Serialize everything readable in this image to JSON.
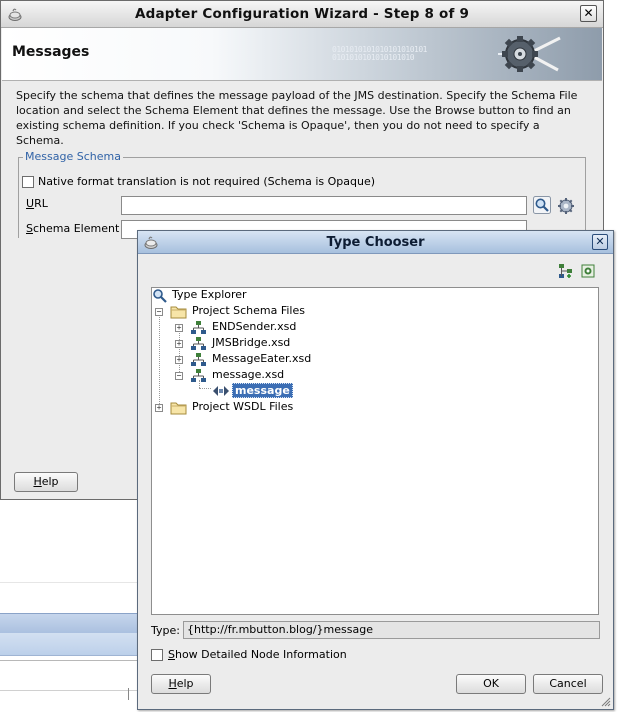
{
  "wizard": {
    "title": "Adapter Configuration Wizard - Step 8 of 9",
    "close_label": "✕",
    "banner_title": "Messages",
    "banner_bits": "0101010101010101010101\n0101010101010101010",
    "description": "Specify the schema that defines the message payload of the JMS destination.  Specify the Schema File location and select the Schema Element that defines the message. Use the Browse button to find an existing schema definition. If you check 'Schema is Opaque', then you do not need to specify a Schema.",
    "message_schema": {
      "legend": "Message Schema",
      "opaque_checkbox_label": "Native format translation is not required (Schema is Opaque)",
      "opaque_checked": false,
      "url_label_mnemonic": "U",
      "url_label_rest": "RL",
      "url_value": "",
      "schema_element_label_mnemonic": "S",
      "schema_element_label_rest": "chema Element",
      "schema_element_value": ""
    },
    "help_mnemonic": "H",
    "help_rest": "elp",
    "icons": [
      "app-icon",
      "search-icon",
      "gear-icon",
      "adapter-gear-icon"
    ]
  },
  "type_chooser": {
    "title": "Type Chooser",
    "close_label": "✕",
    "tree": {
      "root": "Type Explorer",
      "project_schema_files": "Project Schema Files",
      "files": [
        "ENDSender.xsd",
        "JMSBridge.xsd",
        "MessageEater.xsd",
        "message.xsd"
      ],
      "selected_element": "message",
      "project_wsdl_files": "Project WSDL Files"
    },
    "type_label": "Type:",
    "type_value": "{http://fr.mbutton.blog/}message",
    "show_detailed_mnemonic": "S",
    "show_detailed_rest": "how Detailed Node Information",
    "show_detailed_checked": false,
    "help_mnemonic": "H",
    "help_rest": "elp",
    "ok_label": "OK",
    "cancel_label": "Cancel",
    "icons": [
      "import-schema-icon",
      "browse-schema-icon",
      "folder-icon",
      "xsd-file-icon",
      "element-icon"
    ]
  },
  "colors": {
    "dialog_title_bg": "#a7c0de",
    "selection": "#3c6eb4",
    "legend": "#3163a7"
  }
}
